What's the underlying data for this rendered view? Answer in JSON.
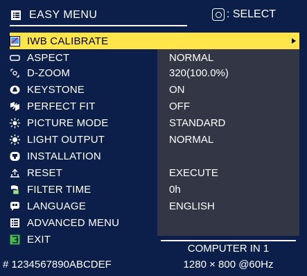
{
  "header": {
    "title": "EASY MENU",
    "title_icon": "menu-list-icon",
    "select_hint": ": SELECT",
    "select_icon": "dpad-enter-icon"
  },
  "menu": {
    "items": [
      {
        "label": "IWB CALIBRATE",
        "icon": "iwb-calibrate-icon",
        "value": "",
        "highlighted": true
      },
      {
        "label": "ASPECT",
        "icon": "aspect-icon",
        "value": "NORMAL"
      },
      {
        "label": "D-ZOOM",
        "icon": "zoom-icon",
        "value": "320(100.0%)"
      },
      {
        "label": "KEYSTONE",
        "icon": "keystone-icon",
        "value": "ON"
      },
      {
        "label": "PERFECT FIT",
        "icon": "perfect-fit-icon",
        "value": "OFF"
      },
      {
        "label": "PICTURE MODE",
        "icon": "picture-mode-icon",
        "value": "STANDARD"
      },
      {
        "label": "LIGHT OUTPUT",
        "icon": "light-output-icon",
        "value": "NORMAL"
      },
      {
        "label": "INSTALLATION",
        "icon": "installation-icon",
        "value": ""
      },
      {
        "label": "RESET",
        "icon": "reset-icon",
        "value": "EXECUTE"
      },
      {
        "label": "FILTER TIME",
        "icon": "filter-icon",
        "value": "0h"
      },
      {
        "label": "LANGUAGE",
        "icon": "language-icon",
        "value": "ENGLISH"
      },
      {
        "label": "ADVANCED MENU",
        "icon": "advanced-menu-icon",
        "value": ""
      },
      {
        "label": "EXIT",
        "icon": "exit-icon",
        "value": ""
      }
    ]
  },
  "footer": {
    "source": "COMPUTER IN 1",
    "resolution": "1280 × 800 @60Hz",
    "id": "# 1234567890ABCDEF"
  },
  "colors": {
    "background": "#0c1f4b",
    "highlight": "#ffe44a",
    "value_panel": "#323645",
    "text": "#ffffff"
  }
}
